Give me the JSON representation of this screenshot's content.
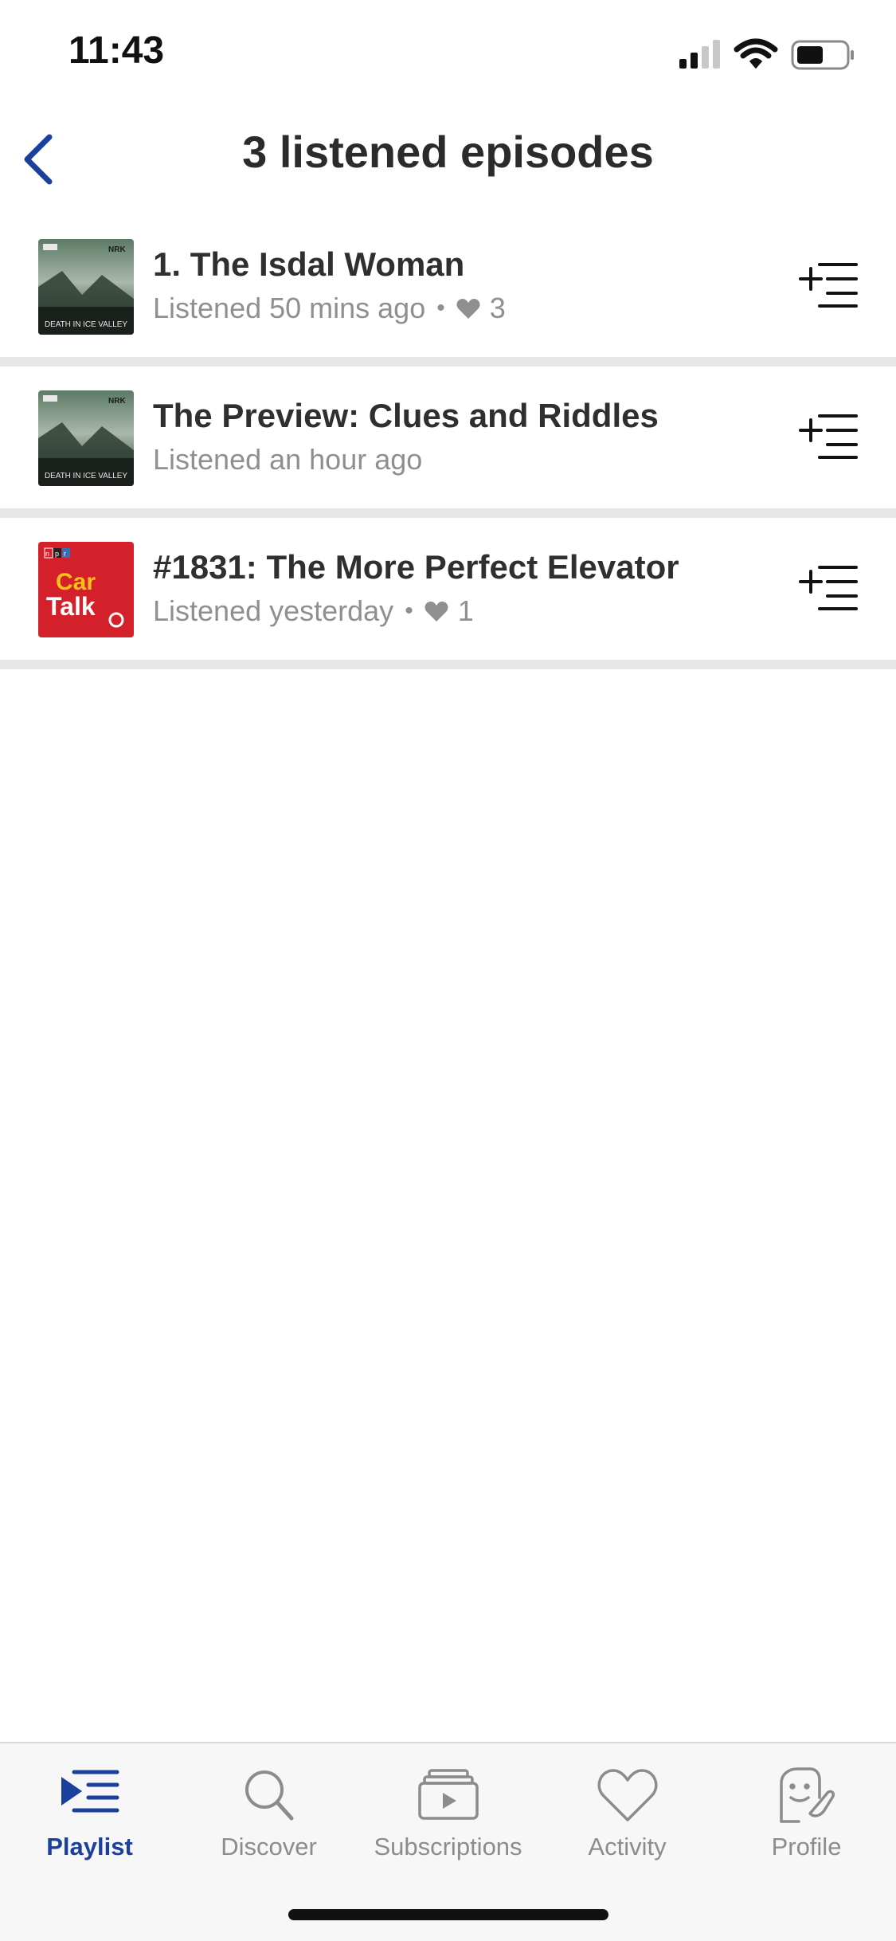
{
  "status_bar": {
    "time": "11:43"
  },
  "header": {
    "title": "3 listened episodes"
  },
  "colors": {
    "accent": "#1a3f9c",
    "divider": "#e7e7e7",
    "meta_text": "#8f8f8f"
  },
  "episodes": [
    {
      "title": "1. The Isdal Woman",
      "listened": "Listened 50 mins ago",
      "likes": "3",
      "artwork": "death-in-ice-valley",
      "artwork_text": "DEATH IN ICE VALLEY"
    },
    {
      "title": "The Preview: Clues and Riddles",
      "listened": "Listened an hour ago",
      "likes": "",
      "artwork": "death-in-ice-valley",
      "artwork_text": "DEATH IN ICE VALLEY"
    },
    {
      "title": "#1831: The More Perfect Elevator",
      "listened": "Listened yesterday",
      "likes": "1",
      "artwork": "car-talk",
      "artwork_text": "Car Talk"
    }
  ],
  "tabs": [
    {
      "label": "Playlist",
      "icon": "playlist-icon",
      "active": true
    },
    {
      "label": "Discover",
      "icon": "search-icon",
      "active": false
    },
    {
      "label": "Subscriptions",
      "icon": "subscriptions-icon",
      "active": false
    },
    {
      "label": "Activity",
      "icon": "heart-icon",
      "active": false
    },
    {
      "label": "Profile",
      "icon": "profile-icon",
      "active": false
    }
  ]
}
